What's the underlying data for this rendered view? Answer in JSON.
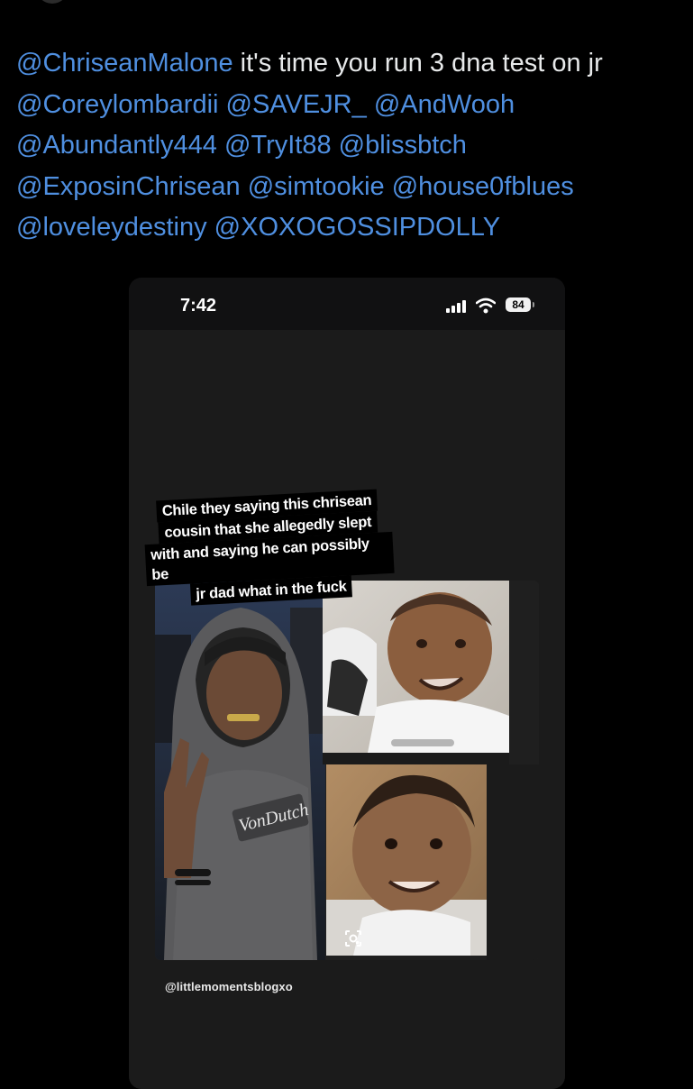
{
  "tweet": {
    "lines": [
      [
        {
          "text": "@ChriseanMalone",
          "type": "mention"
        },
        {
          "text": " it's time you run 3 dna test on jr",
          "type": "text"
        }
      ],
      [
        {
          "text": "@Coreylombardii",
          "type": "mention"
        },
        {
          "text": " ",
          "type": "text"
        },
        {
          "text": "@SAVEJR_",
          "type": "mention"
        },
        {
          "text": " ",
          "type": "text"
        },
        {
          "text": "@AndWooh",
          "type": "mention"
        }
      ],
      [
        {
          "text": "@Abundantly444",
          "type": "mention"
        },
        {
          "text": " ",
          "type": "text"
        },
        {
          "text": "@TryIt88",
          "type": "mention"
        },
        {
          "text": " ",
          "type": "text"
        },
        {
          "text": "@blissbtch",
          "type": "mention"
        }
      ],
      [
        {
          "text": "@ExposinChrisean",
          "type": "mention"
        },
        {
          "text": " ",
          "type": "text"
        },
        {
          "text": "@simtookie",
          "type": "mention"
        },
        {
          "text": " ",
          "type": "text"
        },
        {
          "text": "@house0fblues",
          "type": "mention"
        }
      ],
      [
        {
          "text": "@loveleydestiny",
          "type": "mention"
        },
        {
          "text": " ",
          "type": "text"
        },
        {
          "text": "@XOXOGOSSIPDOLLY",
          "type": "mention"
        }
      ]
    ]
  },
  "screenshot": {
    "status": {
      "time": "7:42",
      "battery": "84"
    },
    "caption_lines": [
      "Chile they saying this chrisean",
      "cousin that she allegedly slept",
      "with and saying he can possibly be",
      "jr dad what in the fuck"
    ],
    "photo_shirt_text": "VonDutch",
    "watermark": "@littlemomentsblogxo"
  },
  "colors": {
    "background": "#000000",
    "text": "#e7e9ea",
    "mention": "#4f8fe0"
  },
  "icons": [
    "signal-icon",
    "wifi-icon",
    "battery-icon",
    "lens-icon"
  ]
}
